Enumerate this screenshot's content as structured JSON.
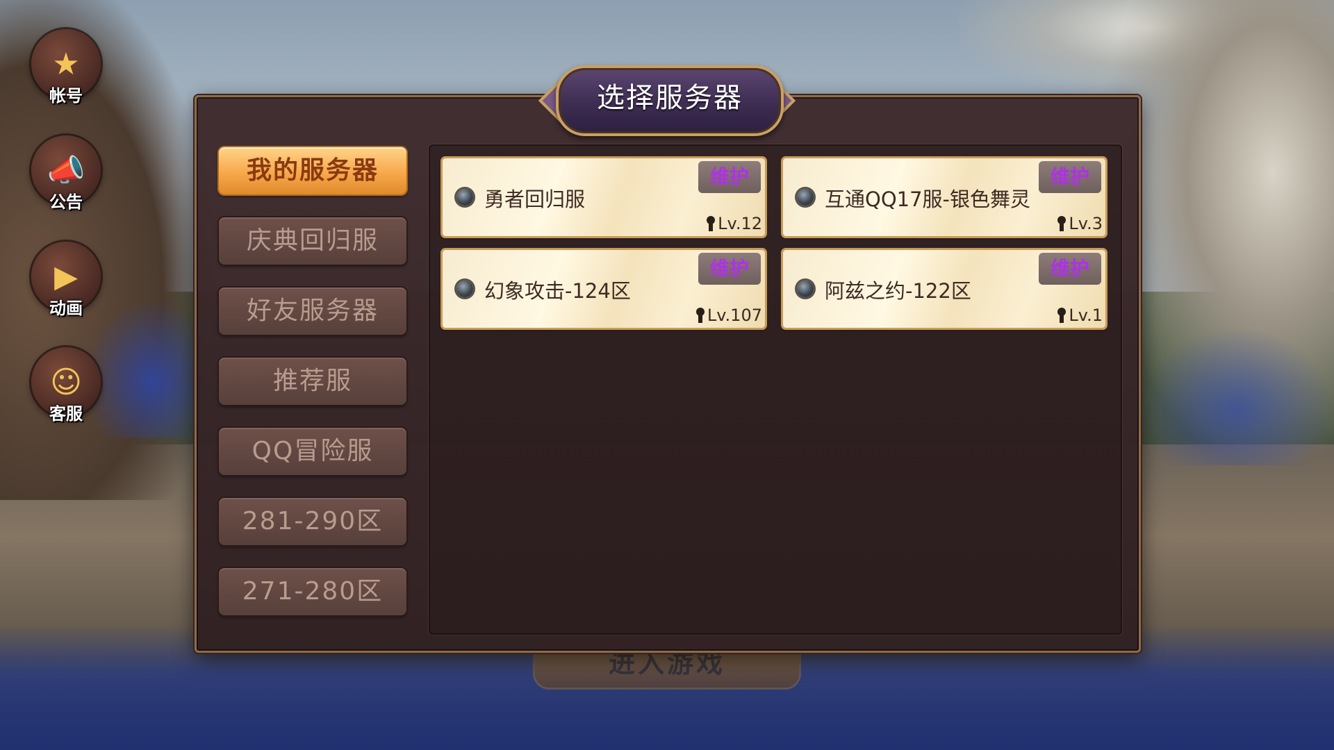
{
  "side_menu": [
    {
      "id": "account",
      "label": "帐号",
      "icon": "book-icon"
    },
    {
      "id": "notice",
      "label": "公告",
      "icon": "megaphone-icon"
    },
    {
      "id": "animation",
      "label": "动画",
      "icon": "play-icon"
    },
    {
      "id": "support",
      "label": "客服",
      "icon": "avatar-icon"
    }
  ],
  "dialog": {
    "title": "选择服务器"
  },
  "tabs": [
    {
      "label": "我的服务器",
      "active": true
    },
    {
      "label": "庆典回归服",
      "active": false
    },
    {
      "label": "好友服务器",
      "active": false
    },
    {
      "label": "推荐服",
      "active": false
    },
    {
      "label": "QQ冒险服",
      "active": false
    },
    {
      "label": "281-290区",
      "active": false
    },
    {
      "label": "271-280区",
      "active": false
    }
  ],
  "servers": [
    {
      "name": "勇者回归服",
      "status": "维护",
      "level": "Lv.12"
    },
    {
      "name": "互通QQ17服-银色舞灵",
      "status": "维护",
      "level": "Lv.3"
    },
    {
      "name": "幻象攻击-124区",
      "status": "维护",
      "level": "Lv.107"
    },
    {
      "name": "阿兹之约-122区",
      "status": "维护",
      "level": "Lv.1"
    }
  ],
  "background": {
    "enter_button": "进入游戏"
  },
  "colors": {
    "active_tab": "#f7a84a",
    "tab": "#6e5049",
    "status_text": "#b030e8",
    "dialog_border": "#8f6b4a"
  }
}
